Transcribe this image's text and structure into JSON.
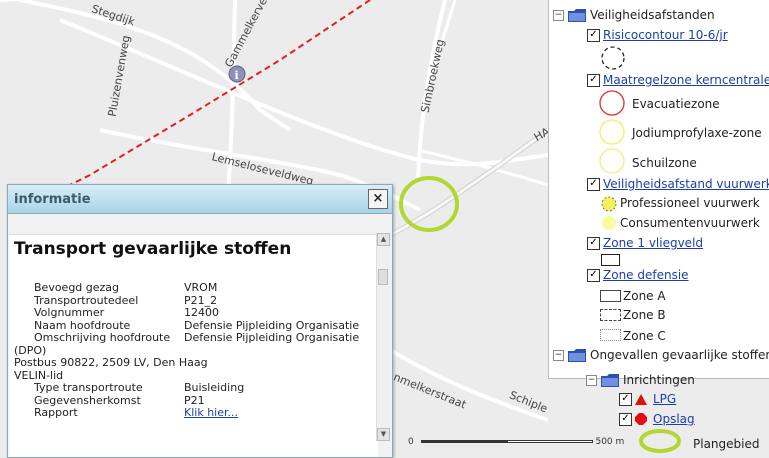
{
  "map": {
    "roads": [
      "Stegdijk",
      "Gammelkerveldweg",
      "Pluizenvenweg",
      "Simbroekweg",
      "Lemseloseveldweg",
      "nmelkerstraat",
      "Schiple",
      "HA"
    ],
    "line_color": "#e02020",
    "plangebied_color": "#b3d630"
  },
  "info": {
    "title": "informatie",
    "close": "×",
    "heading": "Transport gevaarlijke stoffen",
    "rows": [
      {
        "k": "Bevoegd gezag",
        "v": "VROM"
      },
      {
        "k": "Transportroutedeel",
        "v": "P21_2"
      },
      {
        "k": "Volgnummer",
        "v": "12400"
      },
      {
        "k": "Naam hoofdroute",
        "v": "Defensie Pijpleiding Organisatie"
      },
      {
        "k": "Omschrijving hoofdroute",
        "v": "Defensie Pijpleiding Organisatie"
      }
    ],
    "extra": [
      "(DPO)",
      "Postbus 90822, 2509 LV, Den Haag",
      "VELIN-lid"
    ],
    "rows2": [
      {
        "k": "Type transportroute",
        "v": "Buisleiding"
      },
      {
        "k": "Gegevensherkomst",
        "v": "P21"
      },
      {
        "k": "Rapport",
        "v": "Klik hier..."
      }
    ]
  },
  "legend": {
    "veiligheidsafstanden": "Veiligheidsafstanden",
    "risicocontour": "Risicocontour 10-6/jr",
    "maatregelzone": "Maatregelzone kerncentrale",
    "evacuatiezone": "Evacuatiezone",
    "jodium": "Jodiumprofylaxe-zone",
    "schuil": "Schuilzone",
    "vuurwerk": "Veiligheidsafstand vuurwerk",
    "professioneel": "Professioneel vuurwerk",
    "consumenten": "Consumentenvuurwerk",
    "vliegveld": "Zone 1 vliegveld",
    "defensie": "Zone defensie",
    "zone_a": "Zone A",
    "zone_b": "Zone B",
    "zone_c": "Zone C",
    "ongevallen": "Ongevallen gevaarlijke stoffen",
    "inrichtingen": "Inrichtingen",
    "lpg": "LPG",
    "opslag": "Opslag"
  },
  "scalebar": {
    "start": "0",
    "end": "500 m"
  },
  "plangebied": "Plangebied"
}
